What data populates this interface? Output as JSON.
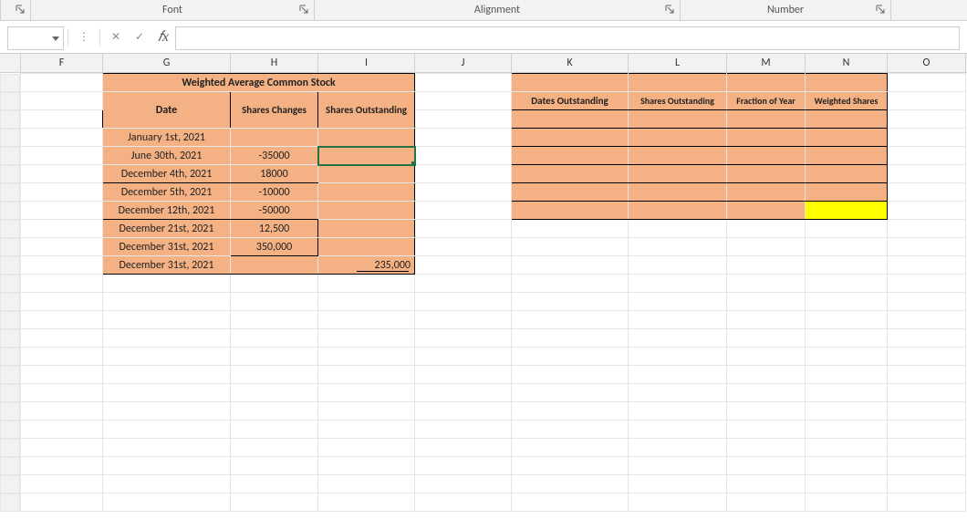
{
  "ribbon": {
    "groups": {
      "font": "Font",
      "alignment": "Alignment",
      "number": "Number"
    }
  },
  "namebox": {
    "value": ""
  },
  "formula": {
    "value": ""
  },
  "fbtns": {
    "cancel": "✕",
    "enter": "✓",
    "fx": "𝑓x"
  },
  "icons": {
    "dots": "⋮"
  },
  "cols": [
    "F",
    "G",
    "H",
    "I",
    "J",
    "K",
    "L",
    "M",
    "N",
    "O"
  ],
  "table1": {
    "title": "Weighted Average Common Stock",
    "hdr_date": "Date",
    "hdr_changes": "Shares Changes",
    "hdr_outstanding": "Shares Outstanding",
    "rows": [
      {
        "date": "January 1st, 2021",
        "chg": "",
        "out": ""
      },
      {
        "date": "June 30th, 2021",
        "chg": "-35000",
        "out": ""
      },
      {
        "date": "December 4th, 2021",
        "chg": "18000",
        "out": ""
      },
      {
        "date": "December 5th, 2021",
        "chg": "-10000",
        "out": ""
      },
      {
        "date": "December 12th, 2021",
        "chg": "-50000",
        "out": ""
      },
      {
        "date": "December 21st, 2021",
        "chg": "12,500",
        "out": ""
      },
      {
        "date": "December 31st, 2021",
        "chg": "350,000",
        "out": ""
      },
      {
        "date": "December 31st, 2021",
        "chg": "",
        "out": "235,000"
      }
    ]
  },
  "table2": {
    "hdr_dates": "Dates Outstanding",
    "hdr_shares": "Shares Outstanding",
    "hdr_fraction": "Fraction of Year",
    "hdr_weighted": "Weighted Shares"
  }
}
